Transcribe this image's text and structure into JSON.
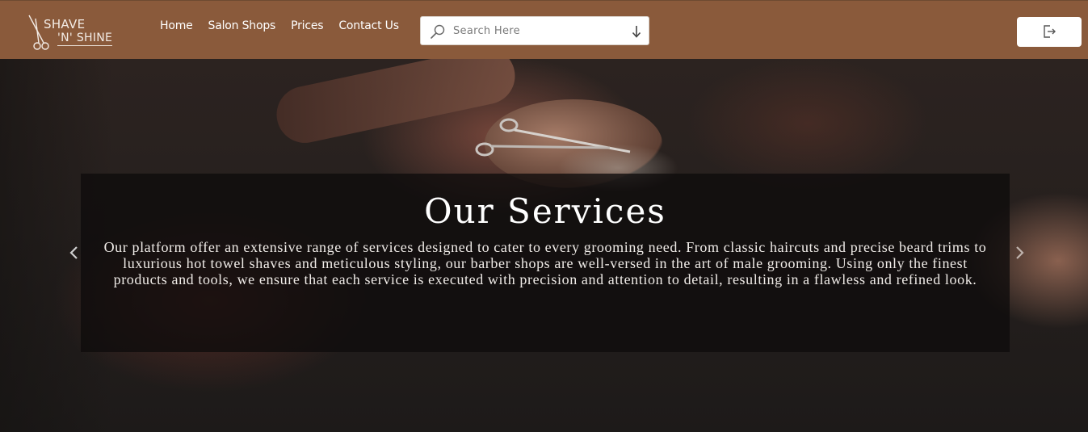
{
  "brand": {
    "line1": "SHAVE",
    "line2": "'N' SHINE"
  },
  "nav": {
    "links": [
      {
        "label": "Home"
      },
      {
        "label": "Salon Shops"
      },
      {
        "label": "Prices"
      },
      {
        "label": "Contact Us"
      }
    ]
  },
  "search": {
    "placeholder": "Search Here",
    "value": ""
  },
  "hero": {
    "title": "Our Services",
    "description": "Our platform offer an extensive range of services designed to cater to every grooming need. From classic haircuts and precise beard trims to luxurious hot towel shaves and meticulous styling, our barber shops are well-versed in the art of male grooming. Using only the finest products and tools, we ensure that each service is executed with precision and attention to detail, resulting in a flawless and refined look."
  },
  "colors": {
    "navbar_bg": "#8a5a3b",
    "caption_bg": "#0e0c0c",
    "text_light": "#ffffff"
  },
  "icons": {
    "logo": "scissors-icon",
    "search": "search-icon",
    "dropdown": "arrow-down-icon",
    "logout": "logout-icon",
    "prev": "chevron-left-icon",
    "next": "chevron-right-icon"
  }
}
